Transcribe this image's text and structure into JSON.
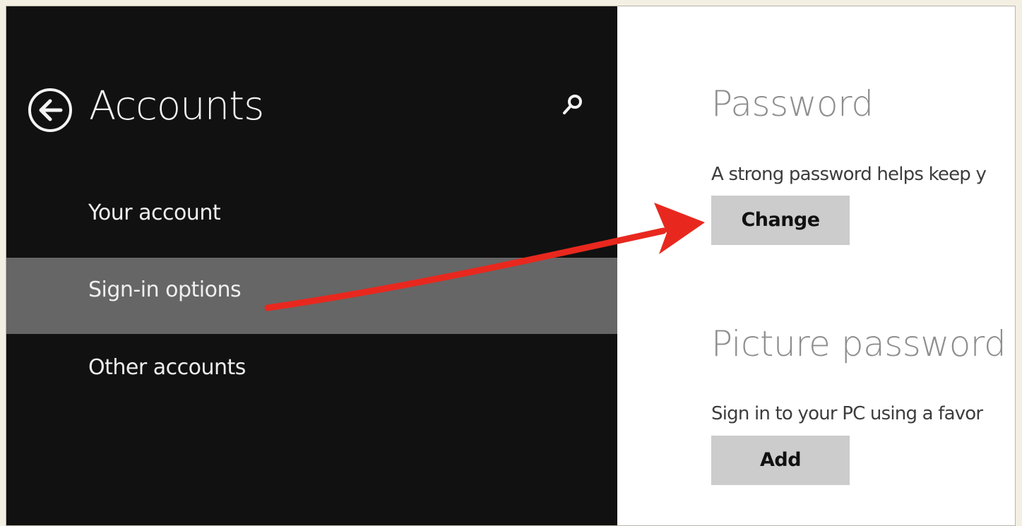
{
  "sidebar": {
    "title": "Accounts",
    "back_icon": "back-arrow-circle-icon",
    "search_icon": "search-icon",
    "items": [
      {
        "label": "Your account",
        "selected": false
      },
      {
        "label": "Sign-in options",
        "selected": true
      },
      {
        "label": "Other accounts",
        "selected": false
      }
    ]
  },
  "content": {
    "password": {
      "title": "Password",
      "description": "A strong password helps keep y",
      "button_label": "Change"
    },
    "picture_password": {
      "title": "Picture password",
      "description": "Sign in to your PC using a favor",
      "button_label": "Add"
    }
  },
  "annotation": {
    "type": "arrow",
    "color": "#e8281e",
    "from": "sidebar-item-sign-in-options",
    "to": "change-password-button"
  },
  "colors": {
    "sidebar_background": "#111111",
    "selected_item_background": "#666666",
    "content_background": "#ffffff",
    "button_background": "#cccccc"
  }
}
